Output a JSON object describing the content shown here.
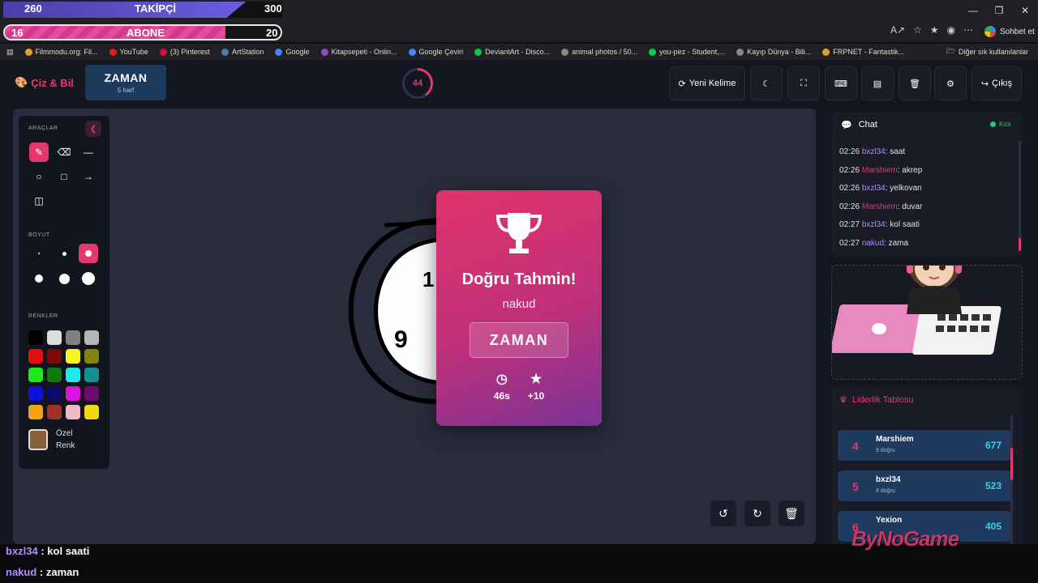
{
  "stream_overlay": {
    "follow": {
      "current": "260",
      "label": "TAKİPÇİ",
      "goal": "300",
      "progress": 0.87
    },
    "subscribe": {
      "current": "16",
      "label": "ABONE",
      "goal": "20",
      "progress": 0.8
    }
  },
  "browser": {
    "copilot_label": "Sohbet et",
    "bookmarks": [
      "Filmmodu.org: Fil...",
      "YouTube",
      "(3) Pinterest",
      "ArtStation",
      "Google",
      "Kitapsepeti - Onlin...",
      "Google Çeviri",
      "DeviantArt - Disco...",
      "animal photos / 50...",
      "you-pez - Student,...",
      "Kayıp Dünya - Bili...",
      "FRPNET - Fantastik..."
    ],
    "other_bookmarks": "Diğer sık kullanılanlar"
  },
  "header": {
    "logo": "Çiz & Bil",
    "word": "ZAMAN",
    "word_hint": "5 harf",
    "timer": "44",
    "timer_fraction": 0.4,
    "new_word": "Yeni Kelime",
    "exit": "Çıkış"
  },
  "tools": {
    "title": "ARAÇLAR",
    "size_title": "BOYUT",
    "colors_title": "RENKLER",
    "custom_color_line1": "Özel",
    "custom_color_line2": "Renk",
    "custom_color": "#8b5e3c",
    "palette": [
      "#000000",
      "#dddddd",
      "#7f7f7f",
      "#b5b5b5",
      "#e01010",
      "#7d0a0a",
      "#f5f51f",
      "#838314",
      "#1ee81e",
      "#0c7d0c",
      "#1ee8e8",
      "#139090",
      "#1010d8",
      "#0b0b6e",
      "#e010e0",
      "#6e0a6e",
      "#f0a21a",
      "#a0302c",
      "#f0b8c8",
      "#f0d810"
    ]
  },
  "modal": {
    "title": "Doğru Tahmin!",
    "user": "nakud",
    "answer": "ZAMAN",
    "time": "46s",
    "points": "+10"
  },
  "chat": {
    "title": "Chat",
    "status": "Kick",
    "messages": [
      {
        "time": "02:26",
        "user": "bxzl34",
        "color": "#b28cff",
        "text": ": saat"
      },
      {
        "time": "02:26",
        "user": "Marshiem",
        "color": "#e5386c",
        "text": ": akrep"
      },
      {
        "time": "02:26",
        "user": "bxzl34",
        "color": "#b28cff",
        "text": ": yelkovan"
      },
      {
        "time": "02:26",
        "user": "Marshiem",
        "color": "#e5386c",
        "text": ": duvar"
      },
      {
        "time": "02:27",
        "user": "bxzl34",
        "color": "#b28cff",
        "text": ": kol saati"
      },
      {
        "time": "02:27",
        "user": "nakud",
        "color": "#b28cff",
        "text": ": zama"
      }
    ]
  },
  "leaderboard": {
    "title": "Liderlik Tablosu",
    "rows": [
      {
        "rank": "4",
        "name": "Marshiem",
        "sub": "9 doğru",
        "score": "677"
      },
      {
        "rank": "5",
        "name": "bxzl34",
        "sub": "8 doğru",
        "score": "523"
      },
      {
        "rank": "6",
        "name": "Yexion",
        "sub": "",
        "score": "405"
      }
    ]
  },
  "stream_chat": [
    {
      "user": "bxzl34",
      "text": " : kol saati"
    },
    {
      "user": "nakud",
      "text": " : zaman"
    }
  ],
  "watermark": "ByNoGame"
}
